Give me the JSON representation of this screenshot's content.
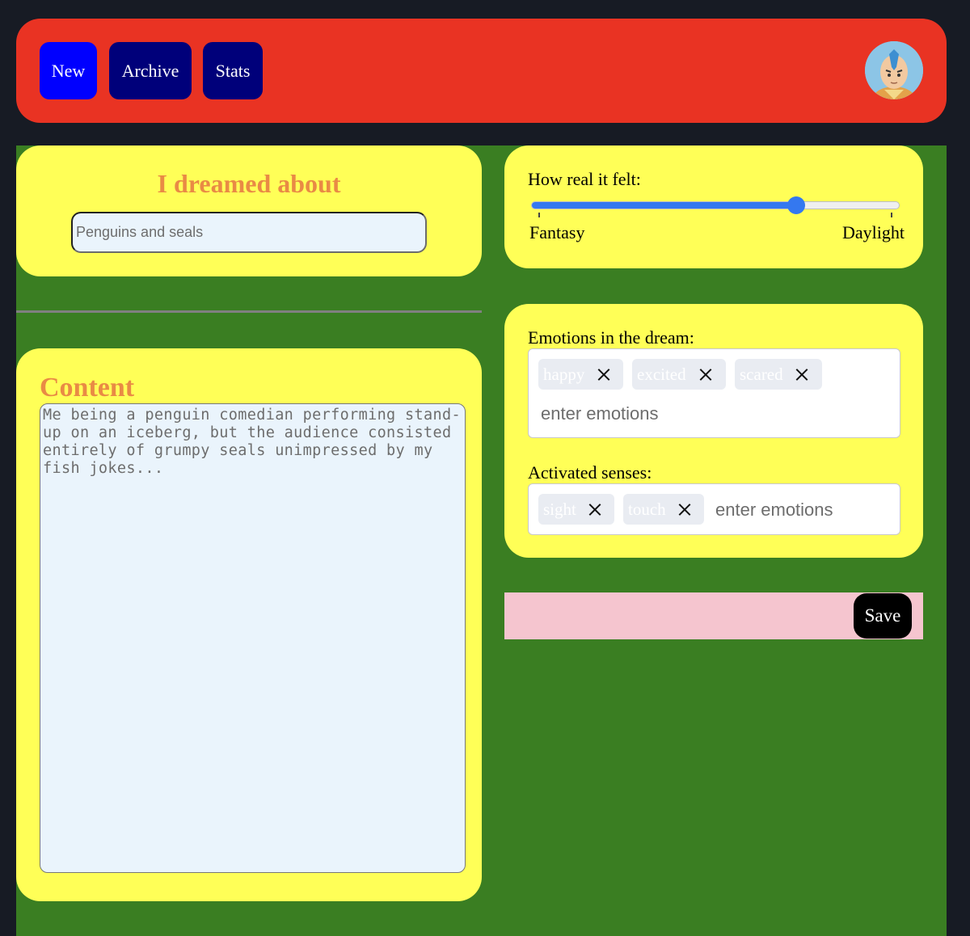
{
  "nav": {
    "new_label": "New",
    "archive_label": "Archive",
    "stats_label": "Stats"
  },
  "dream": {
    "title": "I dreamed about",
    "input_value": "Penguins and seals"
  },
  "content": {
    "title": "Content",
    "text": "Me being a penguin comedian performing stand-up on an iceberg, but the audience consisted entirely of grumpy seals unimpressed by my fish jokes..."
  },
  "realness": {
    "label": "How real it felt:",
    "min_label": "Fantasy",
    "max_label": "Daylight",
    "value_fraction": 0.72
  },
  "emotions": {
    "label": "Emotions in the dream:",
    "tags": [
      "happy",
      "excited",
      "scared"
    ],
    "placeholder": "enter emotions"
  },
  "senses": {
    "label": "Activated senses:",
    "tags": [
      "sight",
      "touch"
    ],
    "placeholder": "enter emotions"
  },
  "save_label": "Save",
  "colors": {
    "page_bg": "#171b24",
    "header_bg": "#e93323",
    "main_bg": "#3a7e22",
    "card_bg": "#ffff57",
    "title_color": "#e98a45",
    "accent": "#3478f0",
    "save_bar_bg": "#f5c5cf"
  },
  "icons": {
    "avatar": "user-avatar-icon",
    "remove_tag": "close-icon"
  }
}
